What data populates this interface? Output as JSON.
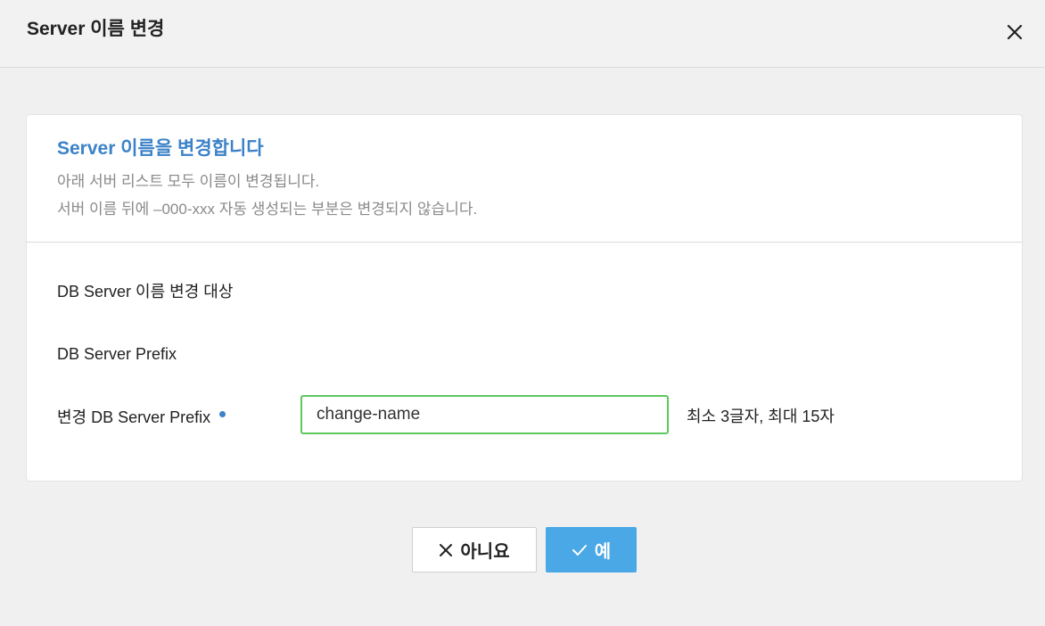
{
  "header": {
    "title": "Server 이름 변경",
    "close_icon": "close-icon"
  },
  "notice": {
    "title": "Server 이름을 변경합니다",
    "line1": "아래 서버 리스트 모두 이름이 변경됩니다.",
    "line2": "서버 이름 뒤에 –000-xxx 자동 생성되는 부분은 변경되지 않습니다."
  },
  "form": {
    "target_label": "DB Server 이름 변경 대상",
    "prefix_label": "DB Server Prefix",
    "new_prefix_label": "변경 DB Server Prefix",
    "new_prefix_value": "change-name",
    "hint": "최소 3글자, 최대 15자"
  },
  "buttons": {
    "no_label": "아니요",
    "yes_label": "예"
  },
  "colors": {
    "accent_blue": "#3c82c8",
    "primary_button": "#4aa8e6",
    "input_focus_border": "#5ec85e"
  }
}
